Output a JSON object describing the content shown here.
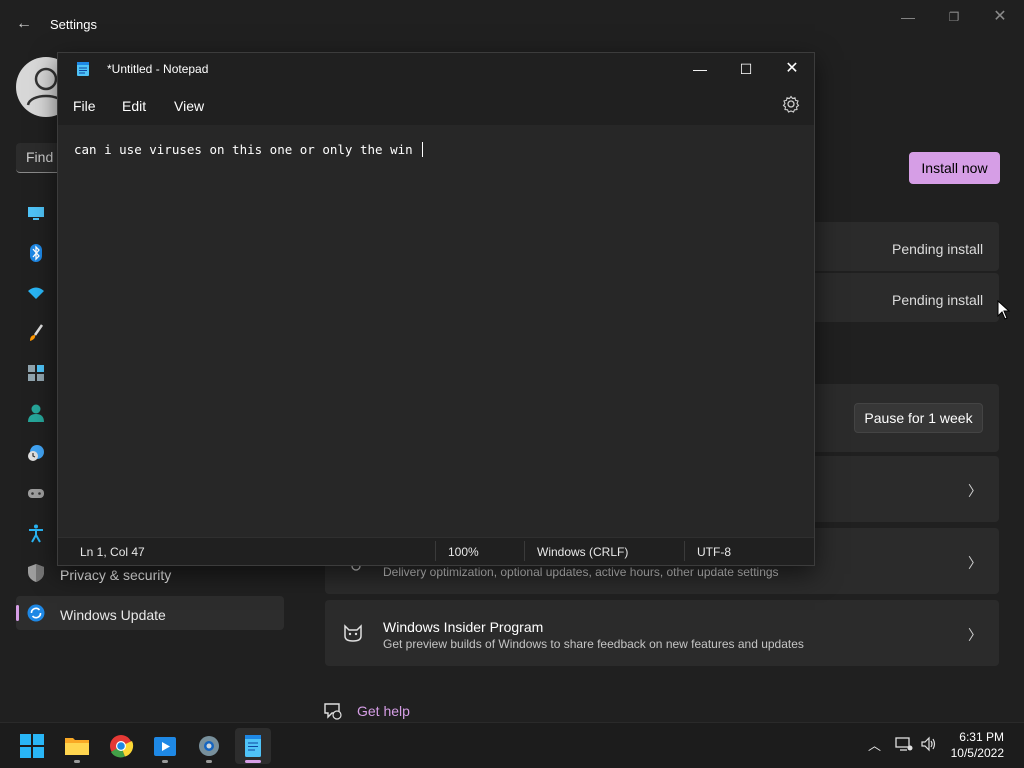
{
  "settings": {
    "title": "Settings",
    "find_placeholder": "Find",
    "nav": {
      "privacy_label": "Privacy & security",
      "update_label": "Windows Update"
    },
    "install_now": "Install now",
    "pending_1": "Pending install",
    "pending_2": "Pending install",
    "pause_label": "Pause for 1 week",
    "advanced_sub": "Delivery optimization, optional updates, active hours, other update settings",
    "insider_title": "Windows Insider Program",
    "insider_sub": "Get preview builds of Windows to share feedback on new features and updates",
    "get_help": "Get help",
    "accent_color": "#d69ee6"
  },
  "notepad": {
    "title": "*Untitled - Notepad",
    "menu": {
      "file": "File",
      "edit": "Edit",
      "view": "View"
    },
    "content": "can i use viruses on this one or only the win ",
    "status": {
      "position": "Ln 1, Col 47",
      "zoom": "100%",
      "line_ending": "Windows (CRLF)",
      "encoding": "UTF-8"
    }
  },
  "taskbar": {
    "time": "6:31 PM",
    "date": "10/5/2022"
  }
}
